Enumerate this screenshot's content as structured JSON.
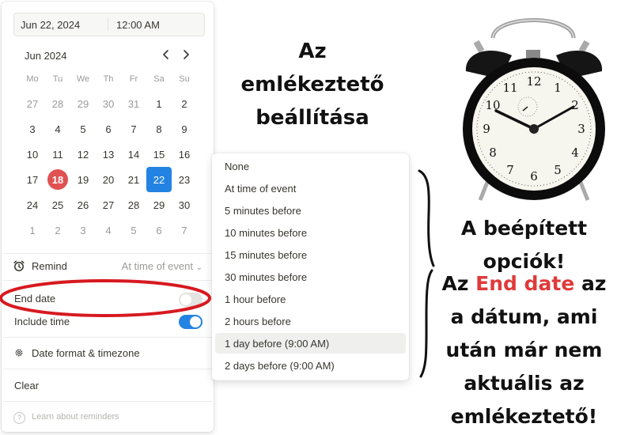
{
  "datepicker": {
    "date_value": "Jun 22, 2024",
    "time_value": "12:00 AM",
    "month_label": "Jun 2024",
    "weekdays": [
      "Mo",
      "Tu",
      "We",
      "Th",
      "Fr",
      "Sa",
      "Su"
    ],
    "weeks": [
      [
        {
          "d": "27",
          "m": true
        },
        {
          "d": "28",
          "m": true
        },
        {
          "d": "29",
          "m": true
        },
        {
          "d": "30",
          "m": true
        },
        {
          "d": "31",
          "m": true
        },
        {
          "d": "1"
        },
        {
          "d": "2"
        }
      ],
      [
        {
          "d": "3"
        },
        {
          "d": "4"
        },
        {
          "d": "5"
        },
        {
          "d": "6"
        },
        {
          "d": "7"
        },
        {
          "d": "8"
        },
        {
          "d": "9"
        }
      ],
      [
        {
          "d": "10"
        },
        {
          "d": "11"
        },
        {
          "d": "12"
        },
        {
          "d": "13"
        },
        {
          "d": "14"
        },
        {
          "d": "15"
        },
        {
          "d": "16"
        }
      ],
      [
        {
          "d": "17"
        },
        {
          "d": "18",
          "today": true
        },
        {
          "d": "19"
        },
        {
          "d": "20"
        },
        {
          "d": "21"
        },
        {
          "d": "22",
          "selected": true
        },
        {
          "d": "23"
        }
      ],
      [
        {
          "d": "24"
        },
        {
          "d": "25"
        },
        {
          "d": "26"
        },
        {
          "d": "27"
        },
        {
          "d": "28"
        },
        {
          "d": "29"
        },
        {
          "d": "30"
        }
      ],
      [
        {
          "d": "1",
          "m": true
        },
        {
          "d": "2",
          "m": true
        },
        {
          "d": "3",
          "m": true
        },
        {
          "d": "4",
          "m": true
        },
        {
          "d": "5",
          "m": true
        },
        {
          "d": "6",
          "m": true
        },
        {
          "d": "7",
          "m": true
        }
      ]
    ],
    "today_color": "#e05252",
    "selected_color": "#2383e2",
    "remind_label": "Remind",
    "remind_value": "At time of event",
    "end_date_label": "End date",
    "end_date_on": false,
    "include_time_label": "Include time",
    "include_time_on": true,
    "date_format_label": "Date format & timezone",
    "clear_label": "Clear",
    "help_label": "Learn about reminders"
  },
  "remind_dropdown": {
    "options": [
      "None",
      "At time of event",
      "5 minutes before",
      "10 minutes before",
      "15 minutes before",
      "30 minutes before",
      "1 hour before",
      "2 hours before",
      "1 day before (9:00 AM)",
      "2 days before (9:00 AM)"
    ],
    "highlighted_index": 8
  },
  "annotations": {
    "title_lines": [
      "Az",
      "emlékeztető",
      "beállítása"
    ],
    "options_lines": [
      "A beépített",
      "opciók!"
    ],
    "end_date_line1_pre": "Az ",
    "end_date_line1_red": "End date",
    "end_date_line1_post": " az",
    "end_date_lines_rest": [
      "a dátum, ami",
      "után már nem",
      "aktuális az",
      "emlékeztető!"
    ],
    "highlight_color": "#e03a3a",
    "circle_color": "#d71920"
  },
  "clock_image": {
    "description": "alarm-clock",
    "numerals": [
      "12",
      "1",
      "2",
      "3",
      "4",
      "5",
      "6",
      "7",
      "8",
      "9",
      "10",
      "11"
    ]
  }
}
